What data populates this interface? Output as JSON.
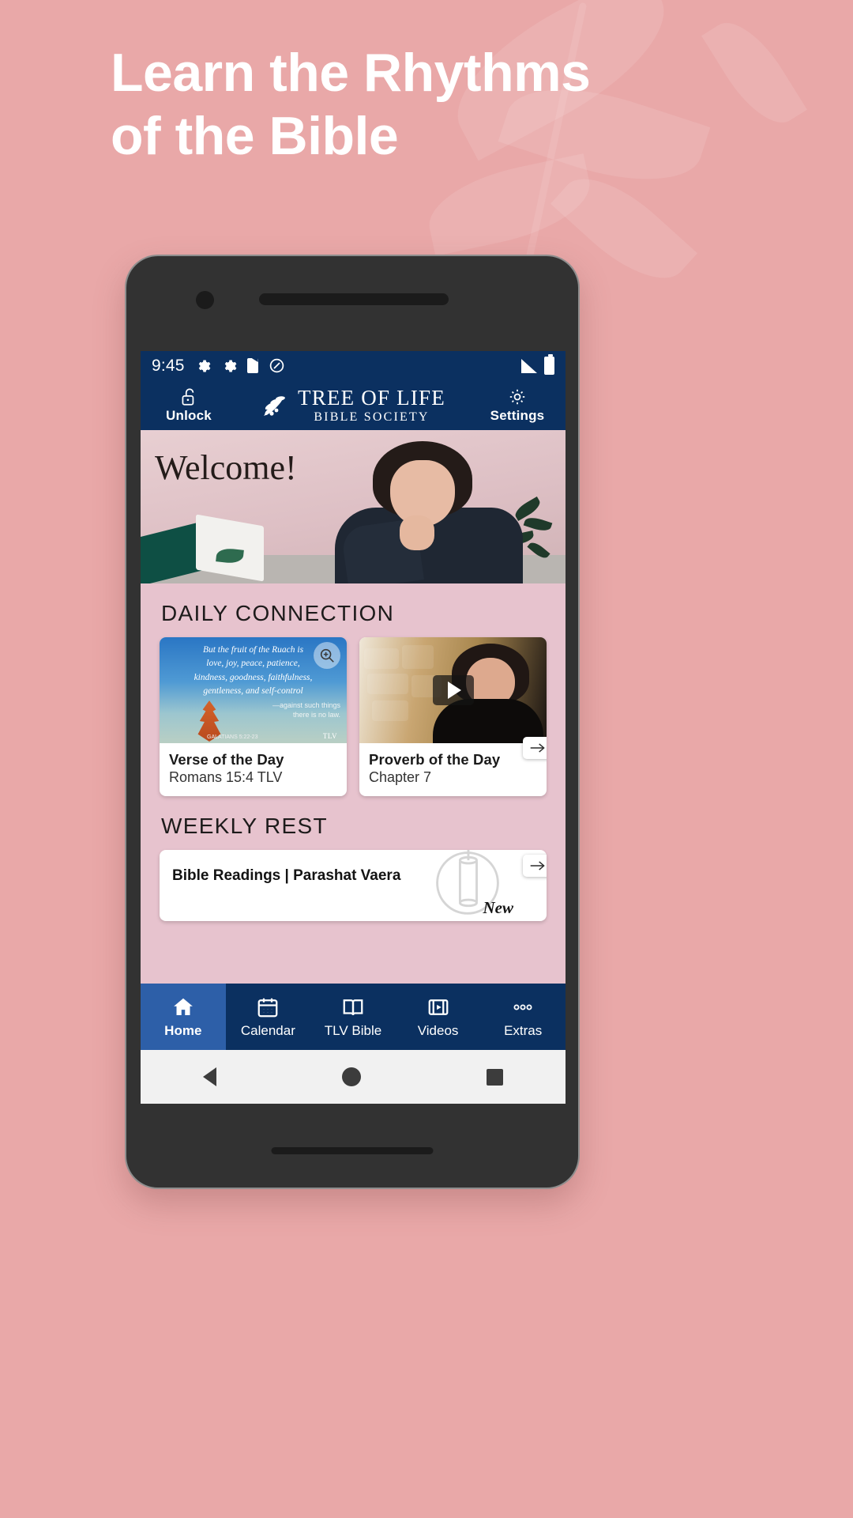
{
  "promo": {
    "headline_line1": "Learn the Rhythms",
    "headline_line2": "of the Bible",
    "bg_color": "#e9a8a8"
  },
  "status_bar": {
    "clock": "9:45",
    "icons": [
      "gear-icon",
      "gear-icon",
      "sd-card-icon",
      "do-not-disturb-icon",
      "signal-icon",
      "battery-icon"
    ]
  },
  "app_bar": {
    "left_button": {
      "icon": "unlock-icon",
      "label": "Unlock"
    },
    "logo": {
      "icon": "olive-branch-icon",
      "line1": "TREE OF LIFE",
      "line2": "BIBLE SOCIETY"
    },
    "right_button": {
      "icon": "gear-icon",
      "label": "Settings"
    },
    "background_color": "#0b3060"
  },
  "hero": {
    "welcome_text": "Welcome!"
  },
  "sections": [
    {
      "title": "DAILY CONNECTION",
      "cards": [
        {
          "title": "Verse of the Day",
          "subtitle": "Romans 15:4 TLV",
          "overlay_icon": "magnify-plus-icon",
          "image_text": {
            "line1": "But the fruit of the Ruach is",
            "line2": "love, joy, peace, patience,",
            "line3": "kindness, goodness, faithfulness,",
            "line4": "gentleness, and self-control",
            "attribution1": "—against such things",
            "attribution2": "there is no law.",
            "reference": "GALATIANS 5:22-23",
            "brand": "TLV"
          }
        },
        {
          "title": "Proverb of the Day",
          "subtitle": "Chapter 7",
          "overlay_icon": "play-icon",
          "corner_icon": "arrow-right-icon"
        }
      ]
    },
    {
      "title": "WEEKLY REST",
      "item": {
        "title": "Bible Readings | Parashat Vaera",
        "badge": "New",
        "corner_icon": "arrow-right-icon",
        "art_icon": "torah-scroll-icon"
      }
    }
  ],
  "bottom_nav": {
    "items": [
      {
        "label": "Home",
        "icon": "home-icon",
        "active": true
      },
      {
        "label": "Calendar",
        "icon": "calendar-icon",
        "active": false
      },
      {
        "label": "TLV Bible",
        "icon": "book-icon",
        "active": false
      },
      {
        "label": "Videos",
        "icon": "video-icon",
        "active": false
      },
      {
        "label": "Extras",
        "icon": "more-dots-icon",
        "active": false
      }
    ],
    "active_color": "#2d5fa8"
  },
  "system_nav": {
    "back": "back-triangle-icon",
    "home": "home-circle-icon",
    "recents": "recents-square-icon"
  }
}
